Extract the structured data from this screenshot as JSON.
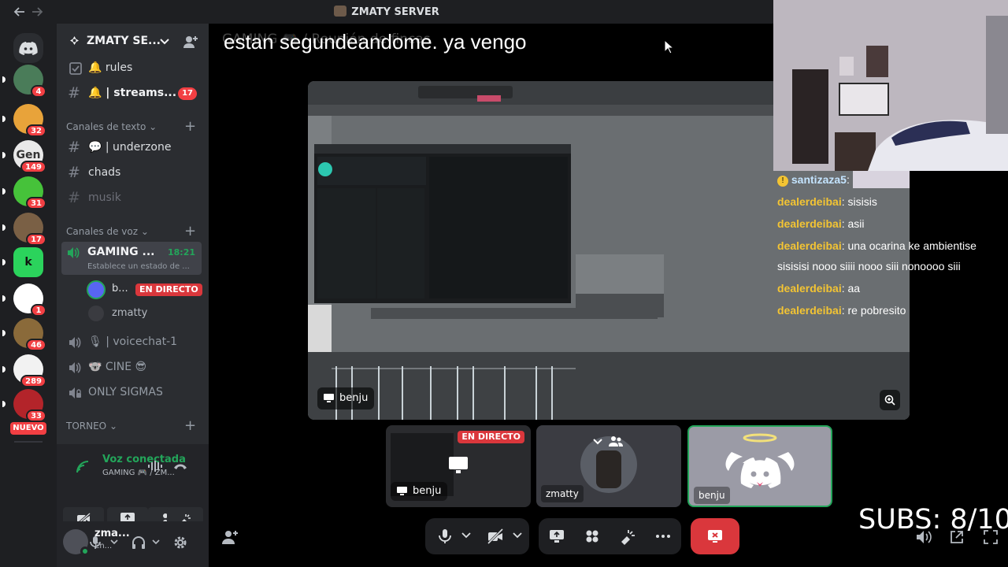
{
  "window": {
    "title": "ZMATY SERVER"
  },
  "overlay": {
    "text": "estan segundeandome. ya vengo",
    "ghost": "GAMING 🎮 / Reunión de fincas"
  },
  "servers": [
    {
      "badge": "4",
      "color": "#4a7c59"
    },
    {
      "badge": "32",
      "color": "#e8a33a"
    },
    {
      "badge": "149",
      "color": "#e9e9e9",
      "label": "Gen"
    },
    {
      "badge": "31",
      "color": "#46c23a"
    },
    {
      "badge": "17",
      "color": "#7a6045"
    },
    {
      "badge": "",
      "color": "#2bd35c",
      "label": "k"
    },
    {
      "badge": "1",
      "color": "#ffffff"
    },
    {
      "badge": "46",
      "color": "#8a6a3a"
    },
    {
      "badge": "289",
      "color": "#f2f2f2"
    },
    {
      "badge": "33",
      "color": "#b3242a"
    }
  ],
  "rail_new_label": "NUEVO",
  "server": {
    "name": "ZMATY SE..."
  },
  "channels_top": [
    {
      "name": "🔔 rules",
      "icon": "rules-icon"
    },
    {
      "name": "🔔 | streams...",
      "count": "17"
    }
  ],
  "text_category": "Canales de texto",
  "text_channels": [
    {
      "name": "💬 | underzone",
      "unread": true
    },
    {
      "name": "chads",
      "unread": true
    },
    {
      "name": "musik",
      "unread": false
    }
  ],
  "voice_category": "Canales de voz",
  "voice_active": {
    "name": "GAMING ...",
    "time": "18:21",
    "status": "Establece un estado de ..."
  },
  "voice_members": [
    {
      "name": "b...",
      "live": "EN DIRECTO"
    },
    {
      "name": "zmatty"
    }
  ],
  "voice_channels": [
    "🎙 | voicechat-1",
    "🐨 CINE 😎",
    "ONLY SIGMAS"
  ],
  "torneo_category": "TORNEO",
  "voice_panel": {
    "status": "Voz conectada",
    "channel": "GAMING 🎮 / ZM..."
  },
  "user": {
    "name": "zma...",
    "status": "En..."
  },
  "main_tile": {
    "name": "benju"
  },
  "chat": [
    {
      "user": "santizaza5",
      "text": "",
      "highlight": true
    },
    {
      "user": "dealerdeibai",
      "text": "sisisis"
    },
    {
      "user": "dealerdeibai",
      "text": "asii"
    },
    {
      "user": "dealerdeibai",
      "text": "una ocarina ke ambientise"
    },
    {
      "user": "",
      "text": "sisisisi nooo siiii nooo siii nonoooo siii"
    },
    {
      "user": "dealerdeibai",
      "text": "aa"
    },
    {
      "user": "dealerdeibai",
      "text": "re pobresito"
    }
  ],
  "subs": "SUBS: 8/10",
  "thumbs": [
    {
      "name": "benju",
      "live": "EN DIRECTO"
    },
    {
      "name": "zmatty"
    },
    {
      "name": "benju"
    }
  ],
  "colors": {
    "accent": "#5865f2",
    "live": "#da373c",
    "green": "#23a55a",
    "badge": "#f23f43",
    "chat_user": "#f3c433"
  }
}
